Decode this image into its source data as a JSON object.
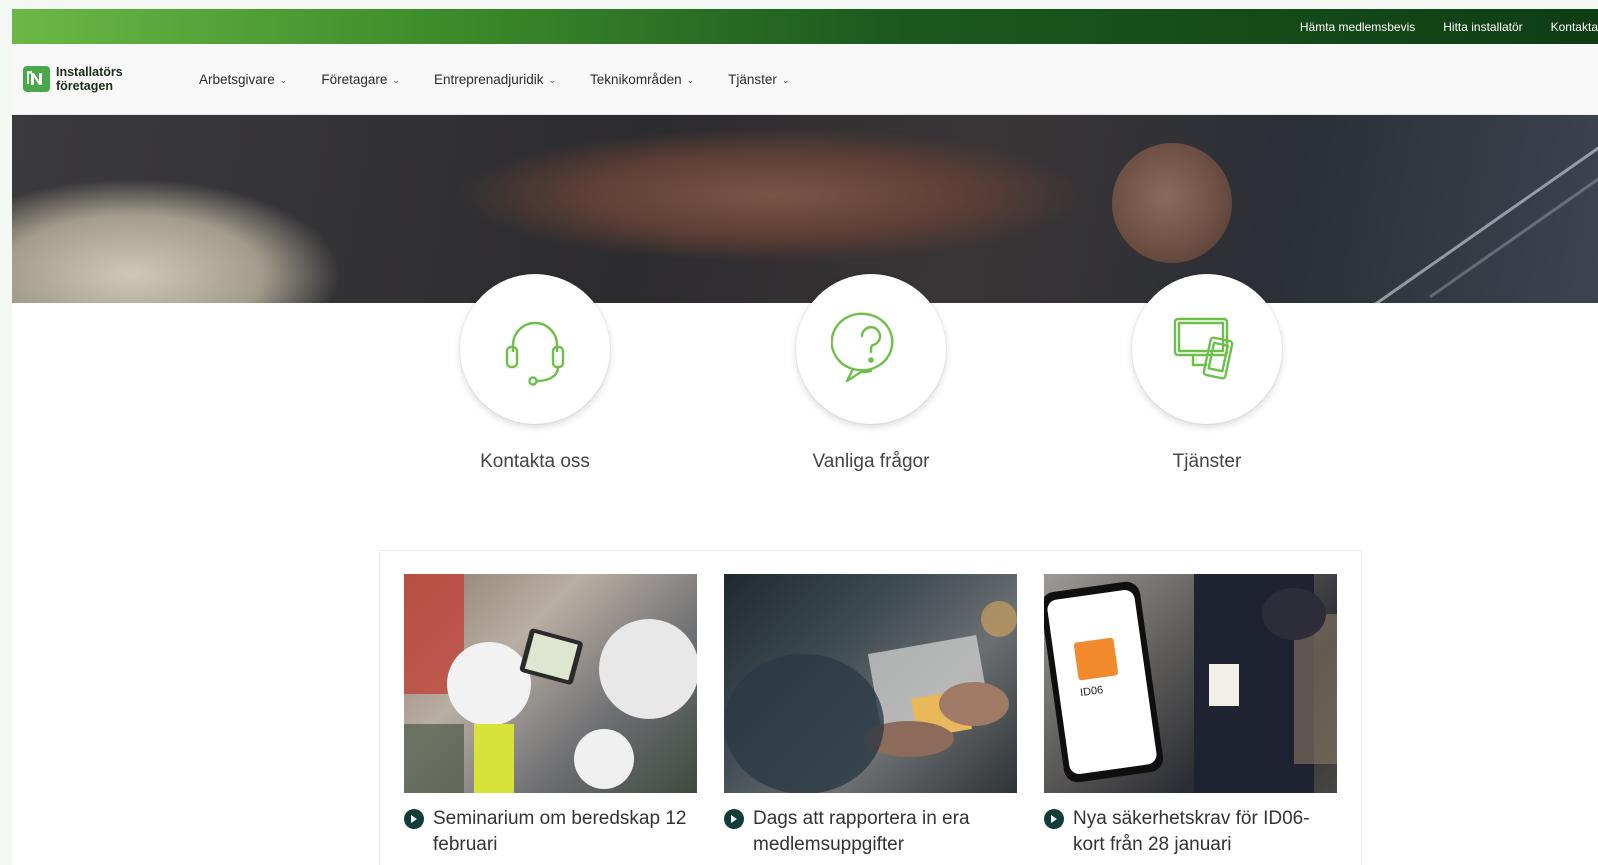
{
  "topbar": {
    "links": [
      "Hämta medlemsbevis",
      "Hitta installatör",
      "Kontakta oss"
    ]
  },
  "logo": {
    "line1": "Installatörs",
    "line2": "företagen",
    "color": "#4aa84a"
  },
  "nav": {
    "items": [
      {
        "label": "Arbetsgivare"
      },
      {
        "label": "Företagare"
      },
      {
        "label": "Entreprenadjuridik"
      },
      {
        "label": "Teknikområden"
      },
      {
        "label": "Tjänster"
      }
    ]
  },
  "quick_links": [
    {
      "label": "Kontakta oss",
      "icon": "headset-icon"
    },
    {
      "label": "Vanliga frågor",
      "icon": "question-bubble-icon"
    },
    {
      "label": "Tjänster",
      "icon": "devices-icon"
    }
  ],
  "news": [
    {
      "title": "Seminarium om beredskap 12 februari"
    },
    {
      "title": "Dags att rapportera in era medlemsuppgifter"
    },
    {
      "title": "Nya säkerhetskrav för ID06-kort från 28 januari"
    }
  ],
  "id06_card": {
    "label": "ID06"
  },
  "colors": {
    "accent_green": "#6cc04a",
    "bullet": "#0f3d3a",
    "topbar_dark": "#0f3d14"
  }
}
